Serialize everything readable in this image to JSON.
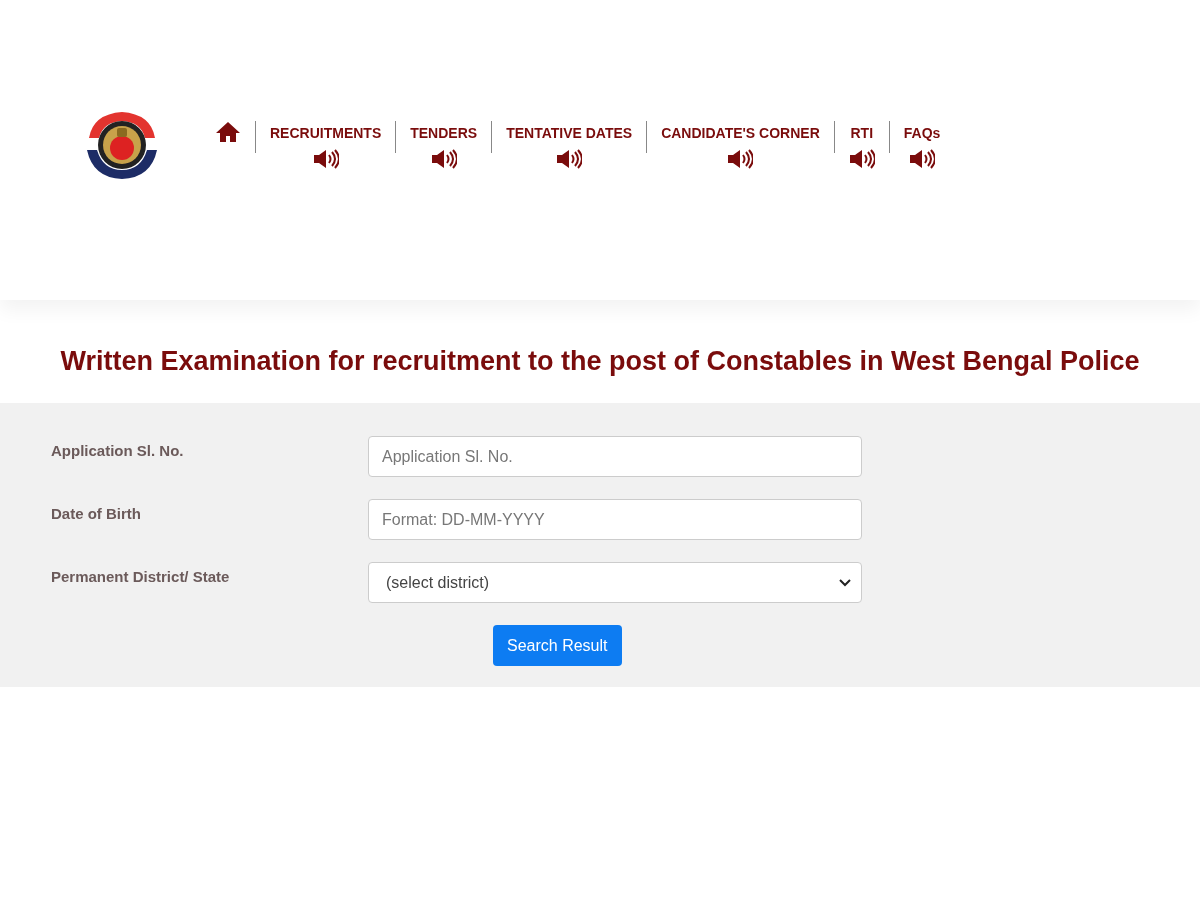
{
  "nav": {
    "items": [
      {
        "kind": "home"
      },
      {
        "kind": "link",
        "label": "RECRUITMENTS"
      },
      {
        "kind": "link",
        "label": "TENDERS"
      },
      {
        "kind": "link",
        "label": "TENTATIVE DATES"
      },
      {
        "kind": "link",
        "label": "CANDIDATE'S CORNER"
      },
      {
        "kind": "link",
        "label": "RTI"
      },
      {
        "kind": "link",
        "label": "FAQs"
      }
    ]
  },
  "headline": "Written Examination for recruitment to the post of Constables in West Bengal Police",
  "form": {
    "fields": [
      {
        "kind": "text",
        "label": "Application Sl. No.",
        "placeholder": "Application Sl. No."
      },
      {
        "kind": "text",
        "label": "Date of Birth",
        "placeholder": "Format: DD-MM-YYYY"
      },
      {
        "kind": "select",
        "label": "Permanent District/ State",
        "value": "(select district)"
      }
    ],
    "button": "Search Result"
  }
}
